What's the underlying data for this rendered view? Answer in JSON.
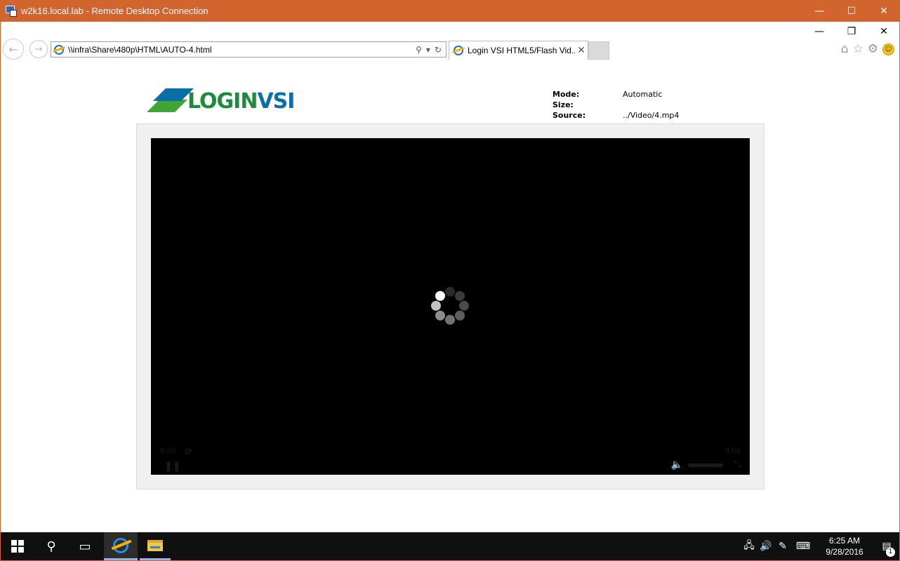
{
  "rdp": {
    "title": "w2k16.local.lab - Remote Desktop Connection",
    "minimize": "—",
    "maximize": "☐",
    "close": "✕"
  },
  "ie": {
    "window_minimize": "—",
    "window_restore": "❐",
    "window_close": "✕",
    "back": "←",
    "forward": "→",
    "address": "\\\\infra\\Share\\480p\\HTML\\AUTO-4.html",
    "search_icon": "⚲",
    "dropdown_icon": "▾",
    "refresh_icon": "↻",
    "tab_label": "Login VSI HTML5/Flash Vid...",
    "tab_close": "✕",
    "home_icon": "⌂",
    "favorites_icon": "☆",
    "tools_icon": "⚙",
    "feedback_icon": "☺"
  },
  "page": {
    "logo_part1": "LOGIN",
    "logo_part2": "VSI",
    "info": [
      {
        "label": "Mode:",
        "value": "Automatic"
      },
      {
        "label": "Size:",
        "value": ""
      },
      {
        "label": "Source:",
        "value": "../Video/4.mp4"
      }
    ]
  },
  "player": {
    "time_current": "0:00",
    "time_total": "0:00",
    "loop_icon": "⟳",
    "pause_icon": "❚❚",
    "volume_icon": "🔈",
    "fullscreen_icon": "⤡"
  },
  "taskbar": {
    "search_icon": "⚲",
    "taskview_icon": "▭",
    "tray_network_icon": "🖧",
    "tray_volume_icon": "🔊",
    "tray_pen_icon": "✎",
    "tray_keyboard_icon": "⌨",
    "time": "6:25 AM",
    "date": "9/28/2016",
    "notification_icon": "▤",
    "notification_count": "1"
  },
  "colors": {
    "rdp_title_bg": "#d2652e",
    "logo_green": "#1e8a3c",
    "logo_blue": "#0a6ea7",
    "taskbar_bg": "#101010"
  }
}
